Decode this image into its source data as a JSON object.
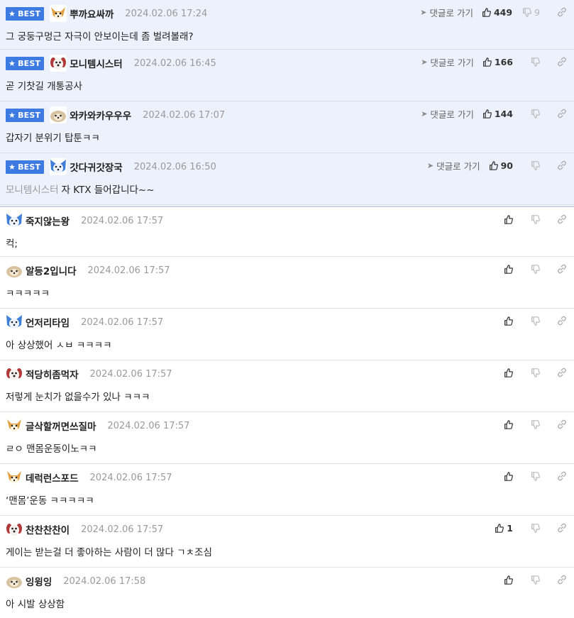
{
  "labels": {
    "best": "BEST",
    "goto_comment": "댓글로 가기"
  },
  "comments": [
    {
      "best": true,
      "avatar": "dog-avatar-orange",
      "nick": "뿌까요싸까",
      "date": "2024.02.06 17:24",
      "text": "그 궁둥구멍근 자극이 안보이는데 좀 벌려볼래?",
      "likes": "449",
      "dislikes": "9"
    },
    {
      "best": true,
      "avatar": "dog-avatar-red",
      "nick": "모니템시스터",
      "date": "2024.02.06 16:45",
      "text": "곧 기찻길 개통공사",
      "likes": "166",
      "dislikes": ""
    },
    {
      "best": true,
      "avatar": "dog-avatar-beige",
      "nick": "와카와카우우우",
      "date": "2024.02.06 17:07",
      "text": "갑자기 분위기 탑툰ㅋㅋ",
      "likes": "144",
      "dislikes": ""
    },
    {
      "best": true,
      "avatar": "dog-avatar-blue",
      "nick": "갓다귀갓장국",
      "date": "2024.02.06 16:50",
      "mention": "모니템시스터",
      "text": "자 KTX 들어갑니다~~",
      "likes": "90",
      "dislikes": ""
    },
    {
      "best": false,
      "avatar": "dog-avatar-blue",
      "nick": "죽지않는왕",
      "date": "2024.02.06 17:57",
      "text": "컥;",
      "likes": "",
      "dislikes": ""
    },
    {
      "best": false,
      "avatar": "dog-avatar-beige",
      "nick": "알등2입니다",
      "date": "2024.02.06 17:57",
      "text": "ㅋㅋㅋㅋㅋ",
      "likes": "",
      "dislikes": ""
    },
    {
      "best": false,
      "avatar": "dog-avatar-blue",
      "nick": "언저리타임",
      "date": "2024.02.06 17:57",
      "text": "아 상상했어 ㅅㅂ ㅋㅋㅋㅋ",
      "likes": "",
      "dislikes": ""
    },
    {
      "best": false,
      "avatar": "dog-avatar-red",
      "nick": "적당히좀먹자",
      "date": "2024.02.06 17:57",
      "text": "저렇게 눈치가 없을수가 있나 ㅋㅋㅋ",
      "likes": "",
      "dislikes": ""
    },
    {
      "best": false,
      "avatar": "dog-avatar-orange",
      "nick": "글삭할꺼면쓰질마",
      "date": "2024.02.06 17:57",
      "text": "ㄹㅇ 맨몸운동이노ㅋㅋ",
      "likes": "",
      "dislikes": ""
    },
    {
      "best": false,
      "avatar": "dog-avatar-orange",
      "nick": "데럭런스포드",
      "date": "2024.02.06 17:57",
      "text": "‘맨몸’운동 ㅋㅋㅋㅋㅋ",
      "likes": "",
      "dislikes": ""
    },
    {
      "best": false,
      "avatar": "dog-avatar-red",
      "nick": "찬찬찬찬이",
      "date": "2024.02.06 17:57",
      "text": "게이는 받는걸 더 좋아하는 사람이 더 많다 ㄱㅊ조심",
      "likes": "1",
      "dislikes": ""
    },
    {
      "best": false,
      "avatar": "dog-avatar-beige",
      "nick": "잉윙잉",
      "date": "2024.02.06 17:58",
      "text": "아 시발 상상함",
      "likes": "",
      "dislikes": ""
    }
  ],
  "colors": {
    "best_badge": "#3d7be3",
    "best_bg": "#edf1fb",
    "date": "#9a9a9a"
  }
}
